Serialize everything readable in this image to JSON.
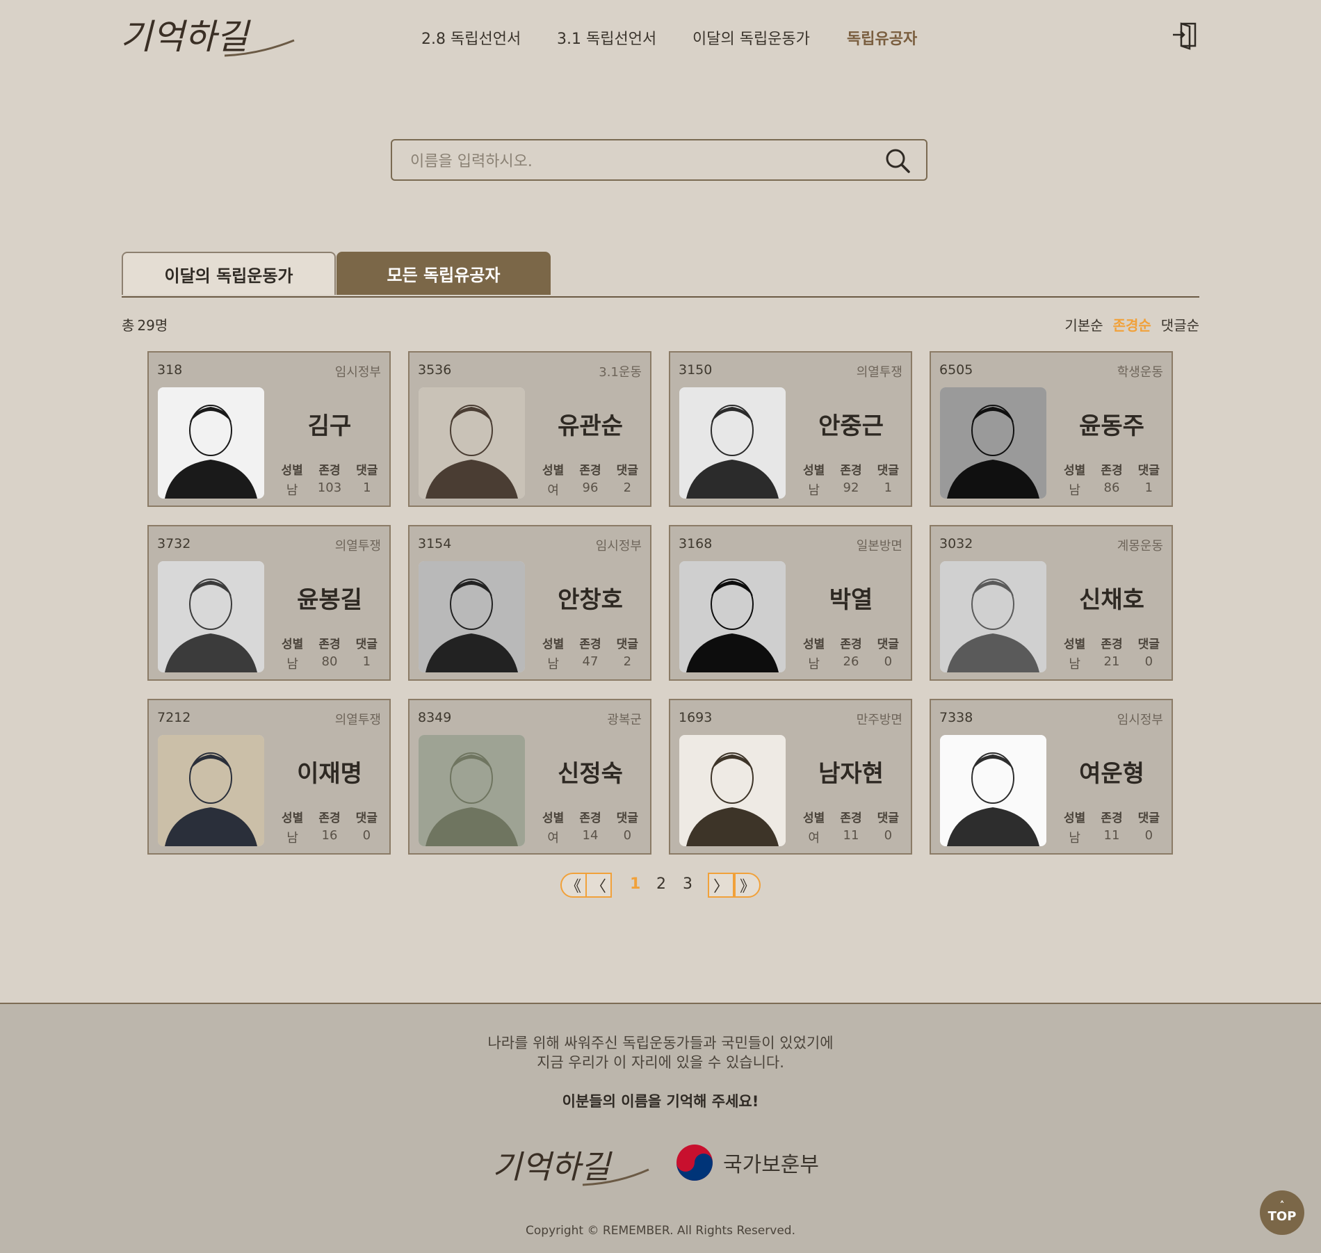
{
  "header": {
    "logo_text": "기억하길",
    "nav": [
      "2.8 독립선언서",
      "3.1 독립선언서",
      "이달의 독립운동가",
      "독립유공자"
    ],
    "login_icon": "login-icon"
  },
  "search": {
    "placeholder": "이름을 입력하시오.",
    "icon": "search-icon"
  },
  "tabs": [
    "이달의 독립운동가",
    "모든 독립유공자"
  ],
  "summary": {
    "prefix": "총",
    "count": "29명"
  },
  "sort_options": [
    "기본순",
    "존경순",
    "댓글순"
  ],
  "sort_active": "존경순",
  "stat_labels": {
    "gender": "성별",
    "respect": "존경",
    "comments": "댓글"
  },
  "cards": [
    {
      "id": "318",
      "category": "임시정부",
      "name": "김구",
      "gender": "남",
      "respect": "103",
      "comments": "1"
    },
    {
      "id": "3536",
      "category": "3.1운동",
      "name": "유관순",
      "gender": "여",
      "respect": "96",
      "comments": "2"
    },
    {
      "id": "3150",
      "category": "의열투쟁",
      "name": "안중근",
      "gender": "남",
      "respect": "92",
      "comments": "1"
    },
    {
      "id": "6505",
      "category": "학생운동",
      "name": "윤동주",
      "gender": "남",
      "respect": "86",
      "comments": "1"
    },
    {
      "id": "3732",
      "category": "의열투쟁",
      "name": "윤봉길",
      "gender": "남",
      "respect": "80",
      "comments": "1"
    },
    {
      "id": "3154",
      "category": "임시정부",
      "name": "안창호",
      "gender": "남",
      "respect": "47",
      "comments": "2"
    },
    {
      "id": "3168",
      "category": "일본방면",
      "name": "박열",
      "gender": "남",
      "respect": "26",
      "comments": "0"
    },
    {
      "id": "3032",
      "category": "계몽운동",
      "name": "신채호",
      "gender": "남",
      "respect": "21",
      "comments": "0"
    },
    {
      "id": "7212",
      "category": "의열투쟁",
      "name": "이재명",
      "gender": "남",
      "respect": "16",
      "comments": "0"
    },
    {
      "id": "8349",
      "category": "광복군",
      "name": "신정숙",
      "gender": "여",
      "respect": "14",
      "comments": "0"
    },
    {
      "id": "1693",
      "category": "만주방면",
      "name": "남자현",
      "gender": "여",
      "respect": "11",
      "comments": "0"
    },
    {
      "id": "7338",
      "category": "임시정부",
      "name": "여운형",
      "gender": "남",
      "respect": "11",
      "comments": "0"
    }
  ],
  "pagination": {
    "pages": [
      "1",
      "2",
      "3"
    ],
    "current": "1",
    "first": "《",
    "prev": "〈",
    "next": "〉",
    "last": "》"
  },
  "footer": {
    "line1": "나라를 위해 싸워주신 독립운동가들과 국민들이 있었기에",
    "line2": "지금 우리가 이 자리에 있을 수 있습니다.",
    "line3": "이분들의 이름을 기억해 주세요!",
    "logo_text": "기억하길",
    "ministry": "국가보훈부",
    "copyright": "Copyright © REMEMBER. All Rights Reserved."
  },
  "top_button": {
    "arrow": "˄",
    "label": "TOP"
  },
  "colors": {
    "background": "#d9d2c8",
    "accent_brown": "#7b6748",
    "accent_orange": "#f1a13a",
    "card_bg": "#bcb5ab"
  }
}
